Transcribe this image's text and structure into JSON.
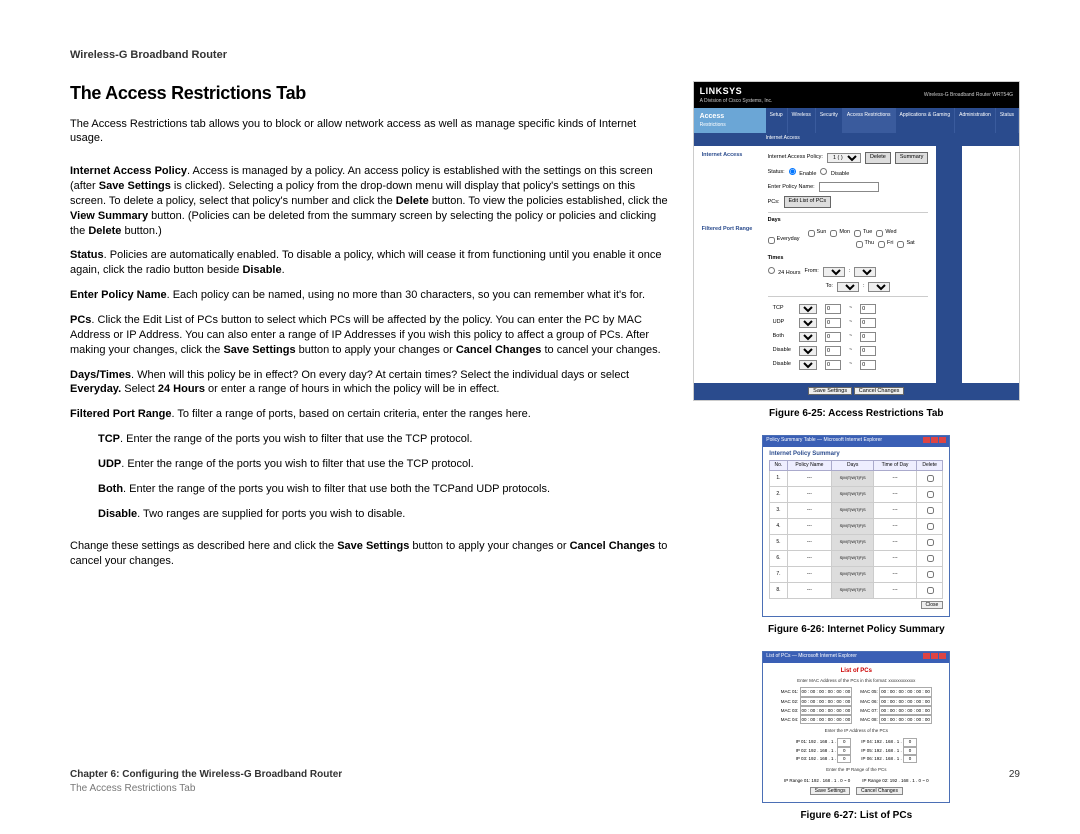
{
  "header": "Wireless-G Broadband Router",
  "title": "The Access Restrictions Tab",
  "para_intro": "The Access Restrictions tab allows you to block or allow network access as well as manage specific kinds of Internet usage.",
  "p_iap": {
    "b0": "Internet Access Policy",
    "t0": ". Access is managed by a policy. An access policy is established with the settings on this screen (after ",
    "b1": "Save Settings",
    "t1": " is clicked). Selecting a policy from the drop-down menu will display that policy's settings on this screen. To delete a policy, select that policy's number and click the ",
    "b2": "Delete",
    "t2": " button. To view the policies established, click the ",
    "b3": "View Summary",
    "t3": " button. (Policies can be deleted from the summary screen by selecting the policy or policies and clicking the ",
    "b4": "Delete",
    "t4": " button.)"
  },
  "p_status": {
    "b0": "Status",
    "t0": ". Policies are automatically enabled. To disable a policy, which will cease it from functioning until you enable it once again, click the radio button beside ",
    "b1": "Disable",
    "t1": "."
  },
  "p_name": {
    "b0": "Enter Policy Name",
    "t0": ". Each policy can be named, using no more than 30 characters, so you can remember what it's for."
  },
  "p_pcs": {
    "b0": "PCs",
    "t0": ". Click the Edit List of PCs button to select which PCs will be affected by the policy. You can enter the PC by MAC Address or IP Address. You can also enter a range of IP Addresses if you wish this policy to affect a group of PCs. After making your changes, click the ",
    "b1": "Save Settings",
    "t1": " button to apply your changes or ",
    "b2": "Cancel Changes",
    "t2": " to cancel your changes."
  },
  "p_days": {
    "b0": "Days/Times",
    "t0": ". When will this policy be in effect? On every day? At certain times? Select the individual days or select ",
    "b1": "Everyday.",
    "t1": " Select ",
    "b2": "24 Hours",
    "t2": " or enter a range of hours in which the policy will be in effect."
  },
  "p_fpr": {
    "b0": "Filtered Port Range",
    "t0": ". To filter a range of ports, based on certain criteria, enter the ranges here."
  },
  "p_tcp": {
    "b0": "TCP",
    "t0": ". Enter the range of the ports you wish to filter that use the TCP protocol."
  },
  "p_udp": {
    "b0": "UDP",
    "t0": ". Enter the range of the ports you wish to filter that use the TCP protocol."
  },
  "p_both": {
    "b0": "Both",
    "t0": ". Enter the range of the ports you wish to filter that use both the TCPand UDP protocols."
  },
  "p_disable": {
    "b0": "Disable",
    "t0": ". Two ranges are supplied for ports you wish to disable."
  },
  "p_final": {
    "t0": "Change these settings as described here and click the ",
    "b1": "Save Settings",
    "t1": " button to apply your changes or ",
    "b2": "Cancel Changes",
    "t2": " to cancel your changes."
  },
  "footer": {
    "line1": "Chapter 6: Configuring the Wireless-G Broadband Router",
    "line2": "The Access Restrictions Tab",
    "page": "29"
  },
  "fig25": {
    "caption": "Figure 6-25: Access Restrictions Tab",
    "brand": "LINKSYS",
    "brand_sub": "A Division of Cisco Systems, Inc.",
    "prod_line": "Wireless-G Broadband Router   WRT54G",
    "big_tab_l1": "Access",
    "big_tab_l2": "Restrictions",
    "tabs": [
      "Setup",
      "Wireless",
      "Security",
      "Access Restrictions",
      "Applications & Gaming",
      "Administration",
      "Status"
    ],
    "subtab": "Internet Access",
    "lbl_iap": "Internet Access Policy:",
    "sel_policy": "1 ( )",
    "btn_delete": "Delete",
    "btn_summary": "Summary",
    "lbl_status": "Status:",
    "opt_enable": "Enable",
    "opt_disable": "Disable",
    "lbl_enter": "Enter Policy Name:",
    "lbl_pcs": "PCs:",
    "btn_editlist": "Edit List of PCs",
    "lbl_days": "Days",
    "chk_everyday": "Everyday",
    "chk_days": [
      "Sun",
      "Mon",
      "Tue",
      "Wed",
      "Thu",
      "Fri",
      "Sat"
    ],
    "lbl_times": "Times",
    "opt_24": "24 Hours",
    "lbl_from": "From:",
    "lbl_to": "To:",
    "lbl_fpr": "Filtered Port Range",
    "port_rows": [
      "TCP",
      "UDP",
      "Both",
      "Disable",
      "Disable"
    ],
    "port_start": "0",
    "port_end": "0",
    "port_sep": "~",
    "btn_save": "Save Settings",
    "btn_cancel": "Cancel Changes"
  },
  "fig26": {
    "caption": "Figure 6-26: Internet Policy Summary",
    "window_title": "Policy Summary Table — Microsoft Internet Explorer",
    "title": "Internet Policy Summary",
    "headers": [
      "No.",
      "Policy Name",
      "Days",
      "Time of Day",
      "Delete"
    ],
    "days_str": "S|M|T|W|T|F|S",
    "dash": "---",
    "rows": 8,
    "btn_close": "Close"
  },
  "fig27": {
    "caption": "Figure 6-27: List of PCs",
    "window_title": "List of PCs — Microsoft Internet Explorer",
    "title": "List of PCs",
    "hint1": "Enter MAC Address of the PCs in this format: xxxxxxxxxxxx",
    "mac_labels": [
      "MAC 01:",
      "MAC 02:",
      "MAC 03:",
      "MAC 04:",
      "MAC 05:",
      "MAC 06:",
      "MAC 07:",
      "MAC 08:"
    ],
    "mac_val": "00 : 00 : 00 : 00 : 00 : 00",
    "hint2": "Enter the IP Address of the PCs",
    "ip_labels": [
      "IP 01:",
      "IP 02:",
      "IP 03:",
      "IP 04:",
      "IP 05:",
      "IP 06:"
    ],
    "ip_prefix": "192 . 168 . 1 .",
    "ip_last": "0",
    "hint3": "Enter the IP Range of the PCs",
    "range_labels": [
      "IP Range 01:",
      "IP Range 02:"
    ],
    "range_val": "192 . 168 . 1 . 0  ~  0",
    "btn_save": "Save Settings",
    "btn_cancel": "Cancel Changes"
  }
}
